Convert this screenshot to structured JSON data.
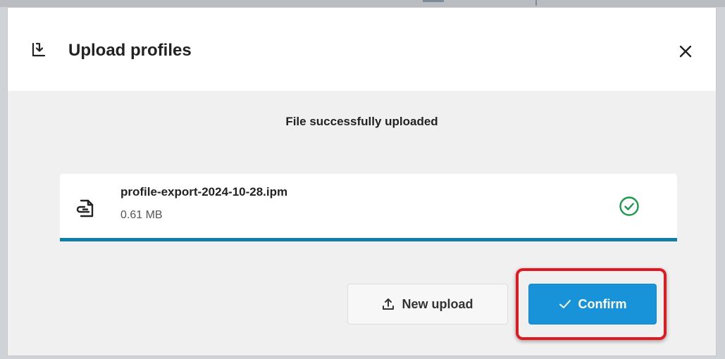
{
  "dialog": {
    "title": "Upload profiles",
    "header_icon": "import-icon",
    "close_icon": "close-icon"
  },
  "upload": {
    "status": "File successfully uploaded",
    "file": {
      "name": "profile-export-2024-10-28.ipm",
      "size": "0.61 MB",
      "icon": "file-link-icon",
      "status_icon": "check-circle-icon",
      "progress_percent": 100
    }
  },
  "actions": {
    "new_upload_label": "New upload",
    "new_upload_icon": "upload-icon",
    "confirm_label": "Confirm",
    "confirm_icon": "checkmark-icon"
  },
  "colors": {
    "primary": "#1892d8",
    "progress": "#117ea5",
    "success": "#1a9a4a",
    "highlight": "#e0181f"
  }
}
